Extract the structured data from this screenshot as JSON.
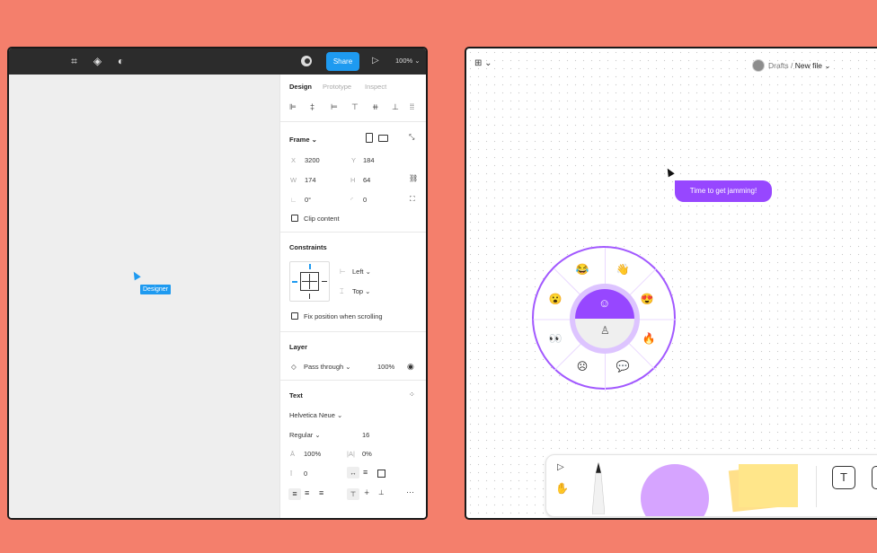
{
  "left": {
    "toolbar": {
      "share_label": "Share",
      "zoom": "100% ⌄"
    },
    "cursor_label": "Designer",
    "panel": {
      "tabs": [
        "Design",
        "Prototype",
        "Inspect"
      ],
      "frame": {
        "title": "Frame ⌄",
        "x_label": "X",
        "x": "3200",
        "y_label": "Y",
        "y": "184",
        "w_label": "W",
        "w": "174",
        "h_label": "H",
        "h": "64",
        "rotation": "0°",
        "radius": "0",
        "clip_label": "Clip content"
      },
      "constraints": {
        "title": "Constraints",
        "horizontal": "Left ⌄",
        "vertical": "Top ⌄",
        "fix_label": "Fix position when scrolling"
      },
      "layer": {
        "title": "Layer",
        "blend": "Pass through ⌄",
        "opacity": "100%"
      },
      "text": {
        "title": "Text",
        "font": "Helvetica Neue ⌄",
        "weight": "Regular ⌄",
        "size": "16",
        "line_height": "100%",
        "letter_spacing": "0%",
        "para_spacing": "0",
        "more": "···"
      }
    }
  },
  "right": {
    "breadcrumb": {
      "folder": "Drafts",
      "sep": "/",
      "file": "New file ⌄"
    },
    "chat_bubble": "Time to get jamming!",
    "wheel_emojis": [
      "😂",
      "👋",
      "😍",
      "🔥",
      "☹",
      "💬",
      "👀",
      "😮"
    ],
    "text_tool": "T"
  },
  "colors": {
    "background": "#f47f6c",
    "accent_blue": "#1e9af0",
    "accent_purple": "#9747ff",
    "sticky": "#ffe68a"
  }
}
